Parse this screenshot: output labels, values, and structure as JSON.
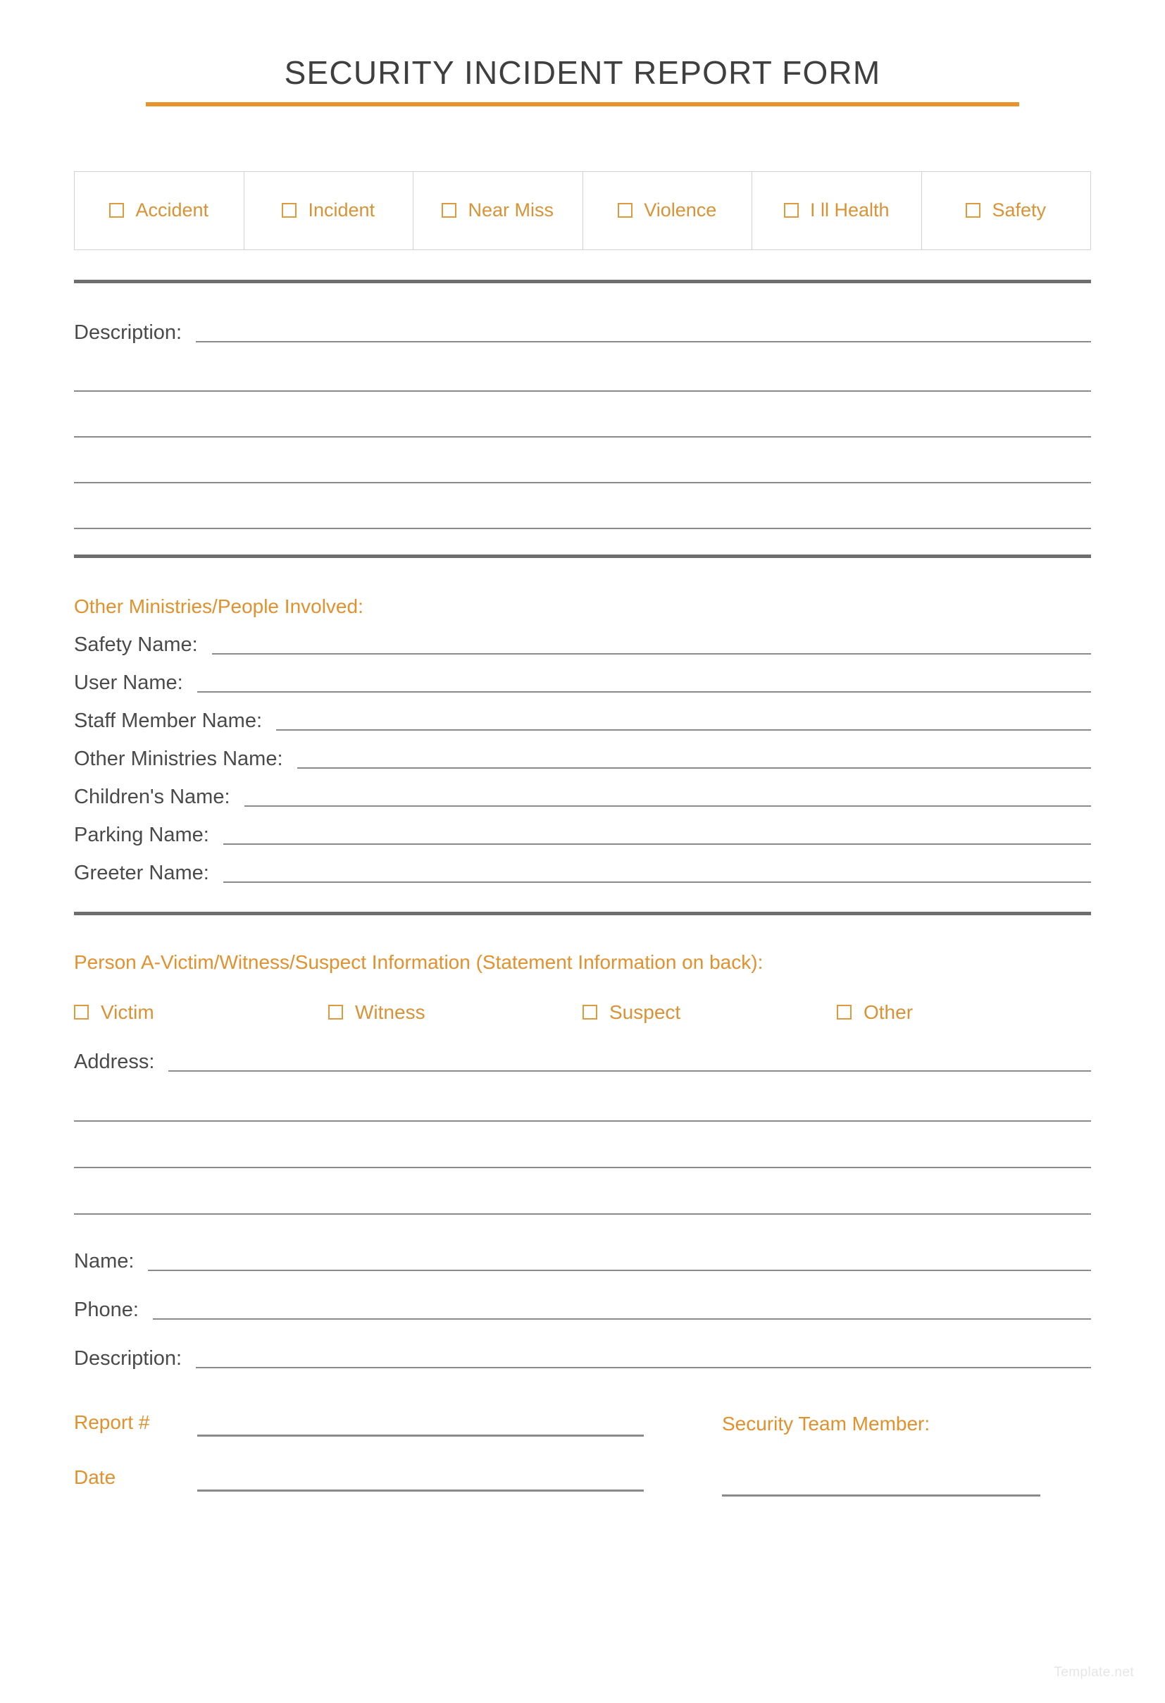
{
  "header": {
    "title": "SECURITY INCIDENT REPORT FORM",
    "accent_color": "#e8942a",
    "rule_color": "#e8942a"
  },
  "incident_types": {
    "items": [
      {
        "label": "Accident",
        "checked": false
      },
      {
        "label": "Incident",
        "checked": false
      },
      {
        "label": "Near Miss",
        "checked": false
      },
      {
        "label": "Violence",
        "checked": false
      },
      {
        "label": "I ll Health",
        "checked": false
      },
      {
        "label": "Safety",
        "checked": false
      }
    ]
  },
  "description_section": {
    "label": "Description:",
    "value": "",
    "extra_lines": 4
  },
  "ministries_section": {
    "heading": "Other Ministries/People Involved:",
    "fields": [
      {
        "label": "Safety Name:",
        "value": ""
      },
      {
        "label": "User Name:",
        "value": ""
      },
      {
        "label": "Staff Member Name:",
        "value": ""
      },
      {
        "label": "Other Ministries Name:",
        "value": ""
      },
      {
        "label": "Children's Name:",
        "value": ""
      },
      {
        "label": "Parking Name:",
        "value": ""
      },
      {
        "label": "Greeter Name:",
        "value": ""
      }
    ]
  },
  "person_section": {
    "heading": "Person A-Victim/Witness/Suspect Information (Statement Information on back):",
    "roles": [
      {
        "label": "Victim",
        "checked": false
      },
      {
        "label": "Witness",
        "checked": false
      },
      {
        "label": "Suspect",
        "checked": false
      },
      {
        "label": "Other",
        "checked": false
      }
    ],
    "address": {
      "label": "Address:",
      "value": "",
      "extra_lines": 3
    },
    "contact_fields": [
      {
        "label": "Name:",
        "value": ""
      },
      {
        "label": "Phone:",
        "value": ""
      },
      {
        "label": "Description:",
        "value": ""
      }
    ]
  },
  "footer": {
    "report_number_label": "Report #",
    "report_number_value": "",
    "date_label": "Date",
    "date_value": "",
    "security_team_member_label": "Security Team Member:",
    "security_team_member_value": ""
  },
  "watermark": {
    "text": "Template.net"
  }
}
